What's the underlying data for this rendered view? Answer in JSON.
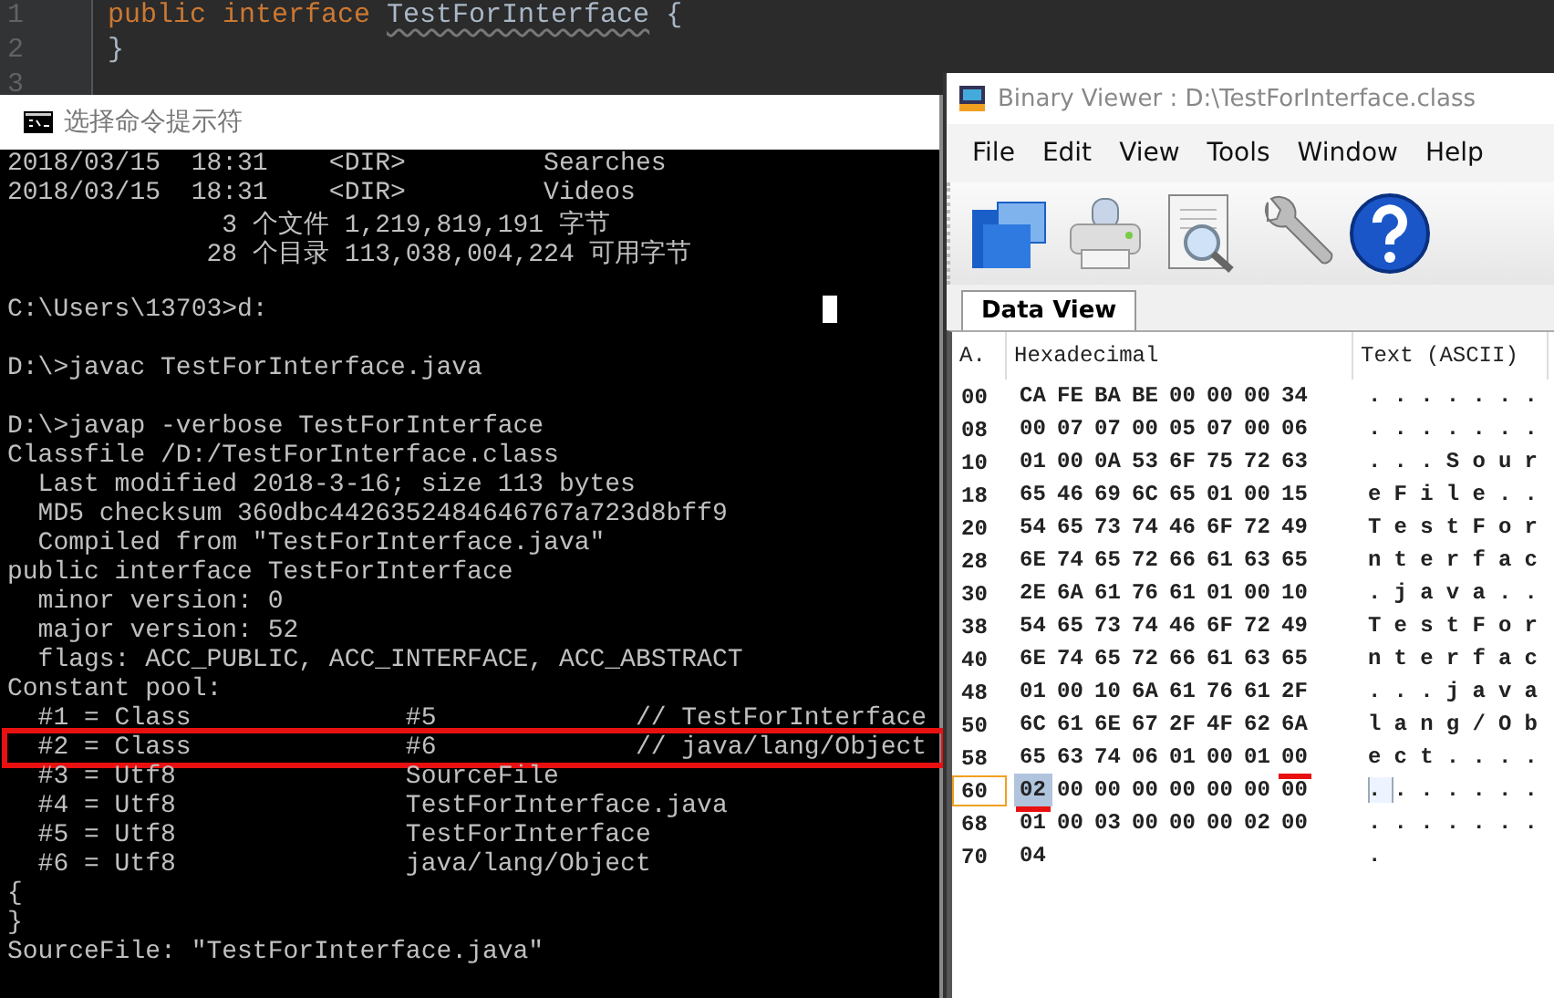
{
  "editor": {
    "lines": [
      {
        "number": "1",
        "tokens": [
          {
            "text": "public",
            "kind": "keyword"
          },
          {
            "text": "interface",
            "kind": "keyword"
          },
          {
            "text": "TestForInterface",
            "kind": "identifier"
          },
          {
            "text": "{",
            "kind": "plain"
          }
        ]
      },
      {
        "number": "2",
        "tokens": [
          {
            "text": "}",
            "kind": "plain"
          }
        ]
      },
      {
        "number": "3"
      }
    ]
  },
  "console": {
    "title": "选择命令提示符",
    "blocks": [
      {
        "lines": [
          {
            "text": "2018/03/15  18:31    <DIR>         Searches"
          },
          {
            "text": "2018/03/15  18:31    <DIR>         Videos"
          },
          {
            "text": "              3 个文件 1,219,819,191 字节"
          },
          {
            "text": "             28 个目录 113,038,004,224 可用字节"
          }
        ]
      },
      {
        "lines": [
          {
            "text": "C:\\Users\\13703>d:",
            "cursor": true
          }
        ]
      },
      {
        "lines": [
          {
            "text": "D:\\>javac TestForInterface.java"
          }
        ]
      },
      {
        "lines": [
          {
            "text": "D:\\>javap -verbose TestForInterface"
          },
          {
            "text": "Classfile /D:/TestForInterface.class"
          },
          {
            "text": "  Last modified 2018-3-16; size 113 bytes"
          },
          {
            "text": "  MD5 checksum 360dbc4426352484646767a723d8bff9"
          },
          {
            "text": "  Compiled from \"TestForInterface.java\""
          },
          {
            "text": "public interface TestForInterface"
          },
          {
            "text": "  minor version: 0"
          },
          {
            "text": "  major version: 52"
          },
          {
            "text": "  flags: ACC_PUBLIC, ACC_INTERFACE, ACC_ABSTRACT"
          },
          {
            "text": "Constant pool:"
          },
          {
            "text": "  #1 = Class              #5             // TestForInterface"
          },
          {
            "text": "  #2 = Class              #6             // java/lang/Object",
            "highlighted": true
          },
          {
            "text": "  #3 = Utf8               SourceFile"
          },
          {
            "text": "  #4 = Utf8               TestForInterface.java"
          },
          {
            "text": "  #5 = Utf8               TestForInterface"
          },
          {
            "text": "  #6 = Utf8               java/lang/Object"
          },
          {
            "text": "{"
          },
          {
            "text": "}"
          },
          {
            "text": "SourceFile: \"TestForInterface.java\""
          }
        ]
      }
    ]
  },
  "viewer": {
    "title": "Binary Viewer : D:\\TestForInterface.class",
    "menu": [
      "File",
      "Edit",
      "View",
      "Tools",
      "Window",
      "Help"
    ],
    "tabs": [
      {
        "label": "Data View",
        "selected": true
      }
    ],
    "columns": [
      "A.",
      "Hexadecimal",
      "Text (ASCII)"
    ],
    "rows": [
      {
        "address": "00",
        "hex": "CA FE BA BE 00 00 00 34",
        "ascii": ".......",
        "current": false
      },
      {
        "address": "08",
        "hex": "00 07 07 00 05 07 00 06",
        "ascii": ".......",
        "current": false
      },
      {
        "address": "10",
        "hex": "01 00 0A 53 6F 75 72 63",
        "ascii": "...Sour",
        "current": false
      },
      {
        "address": "18",
        "hex": "65 46 69 6C 65 01 00 15",
        "ascii": "eFile..",
        "current": false
      },
      {
        "address": "20",
        "hex": "54 65 73 74 46 6F 72 49",
        "ascii": "TestFor",
        "current": false
      },
      {
        "address": "28",
        "hex": "6E 74 65 72 66 61 63 65",
        "ascii": "nterfac",
        "current": false
      },
      {
        "address": "30",
        "hex": "2E 6A 61 76 61 01 00 10",
        "ascii": ".java..",
        "current": false
      },
      {
        "address": "38",
        "hex": "54 65 73 74 46 6F 72 49",
        "ascii": "TestFor",
        "current": false
      },
      {
        "address": "40",
        "hex": "6E 74 65 72 66 61 63 65",
        "ascii": "nterfac",
        "current": false
      },
      {
        "address": "48",
        "hex": "01 00 10 6A 61 76 61 2F",
        "ascii": "...java",
        "current": false
      },
      {
        "address": "50",
        "hex": "6C 61 6E 67 2F 4F 62 6A",
        "ascii": "lang/Ob",
        "current": false
      },
      {
        "address": "58",
        "hex": "65 63 74 06 01 00 01 00",
        "ascii": "ect....",
        "current": false,
        "underline_last": true
      },
      {
        "address": "60",
        "hex": "02 00 00 00 00 00 00 00",
        "ascii": ".......",
        "current": true,
        "underline_first": true
      },
      {
        "address": "68",
        "hex": "01 00 03 00 00 00 02 00",
        "ascii": ".......",
        "current": false
      },
      {
        "address": "70",
        "hex": "04",
        "ascii": ".",
        "current": false
      }
    ]
  }
}
